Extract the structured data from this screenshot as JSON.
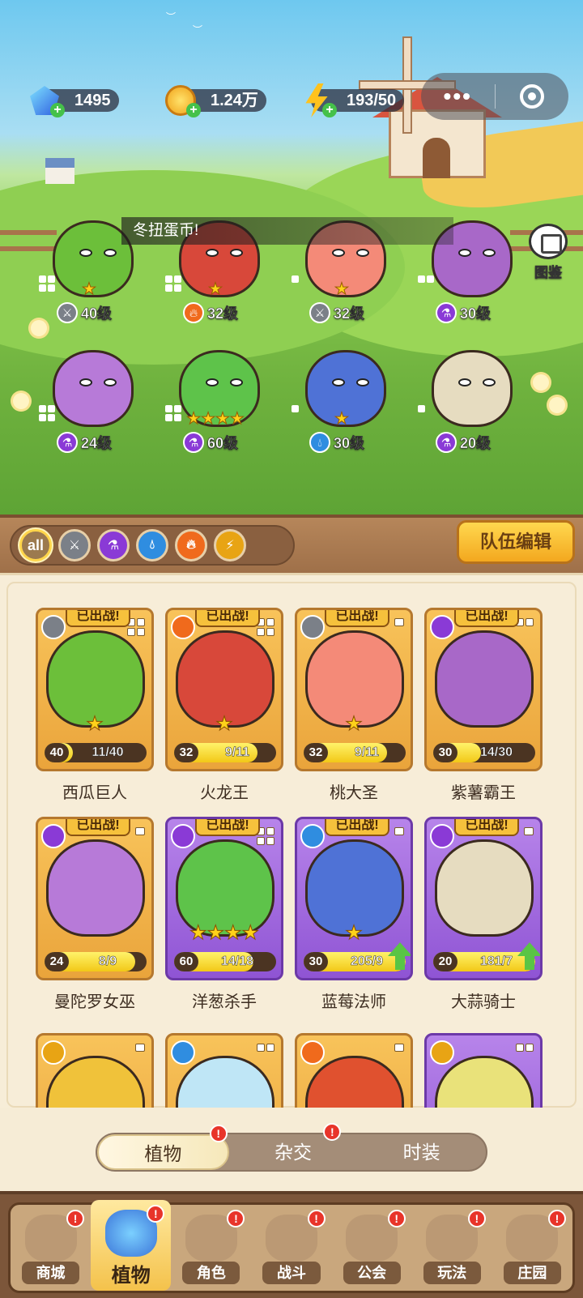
{
  "currencies": {
    "gems": "1495",
    "coins": "1.24万",
    "energy": "193/50"
  },
  "capsule": {
    "more": "•••"
  },
  "ticker": "冬扭蛋币!",
  "codex_label": "图鉴",
  "scene_plants": [
    {
      "level": "40级",
      "element": "sword-icon",
      "stars": "★"
    },
    {
      "level": "32级",
      "element": "fire-icon",
      "stars": "★"
    },
    {
      "level": "32级",
      "element": "sword-icon",
      "stars": "★"
    },
    {
      "level": "30级",
      "element": "potion-icon",
      "stars": ""
    },
    {
      "level": "24级",
      "element": "potion-icon",
      "stars": ""
    },
    {
      "level": "60级",
      "element": "potion-icon",
      "stars": "★★★★"
    },
    {
      "level": "30级",
      "element": "water-icon",
      "stars": "★"
    },
    {
      "level": "20级",
      "element": "potion-icon",
      "stars": ""
    }
  ],
  "filter": {
    "all_label": "all"
  },
  "team_edit_label": "队伍编辑",
  "deployed_label": "已出战!",
  "cards": [
    {
      "name": "西瓜巨人",
      "level": "40",
      "progress": "11/40",
      "fill": 0.28,
      "stars": "★",
      "element": "sword-icon",
      "frame": "gold",
      "color": "#6cbf3a"
    },
    {
      "name": "火龙王",
      "level": "32",
      "progress": "9/11",
      "fill": 0.82,
      "stars": "★",
      "element": "fire-icon",
      "frame": "gold",
      "color": "#d8483a"
    },
    {
      "name": "桃大圣",
      "level": "32",
      "progress": "9/11",
      "fill": 0.82,
      "stars": "★",
      "element": "sword-icon",
      "frame": "gold",
      "color": "#f48a78"
    },
    {
      "name": "紫薯霸王",
      "level": "30",
      "progress": "14/30",
      "fill": 0.47,
      "stars": "",
      "element": "potion-icon",
      "frame": "gold",
      "color": "#a868c8"
    },
    {
      "name": "曼陀罗女巫",
      "level": "24",
      "progress": "8/9",
      "fill": 0.89,
      "stars": "",
      "element": "potion-icon",
      "frame": "gold",
      "color": "#b77ad8"
    },
    {
      "name": "洋葱杀手",
      "level": "60",
      "progress": "14/18",
      "fill": 0.78,
      "stars": "★★★★",
      "element": "potion-icon",
      "frame": "purple",
      "color": "#5ec34a"
    },
    {
      "name": "蓝莓法师",
      "level": "30",
      "progress": "205/9",
      "fill": 1.0,
      "stars": "★",
      "element": "water-icon",
      "frame": "purple",
      "color": "#4f72d6"
    },
    {
      "name": "大蒜骑士",
      "level": "20",
      "progress": "181/7",
      "fill": 1.0,
      "stars": "",
      "element": "potion-icon",
      "frame": "purple",
      "color": "#e6dcc0"
    }
  ],
  "tabs": [
    {
      "label": "植物",
      "active": true,
      "alert": "!"
    },
    {
      "label": "杂交",
      "active": false,
      "alert": "!"
    },
    {
      "label": "时装",
      "active": false,
      "alert": ""
    }
  ],
  "nav": [
    {
      "label": "商城",
      "alert": "!"
    },
    {
      "label": "植物",
      "alert": "!"
    },
    {
      "label": "角色",
      "alert": "!"
    },
    {
      "label": "战斗",
      "alert": "!"
    },
    {
      "label": "公会",
      "alert": "!"
    },
    {
      "label": "玩法",
      "alert": "!"
    },
    {
      "label": "庄园",
      "alert": "!"
    }
  ]
}
